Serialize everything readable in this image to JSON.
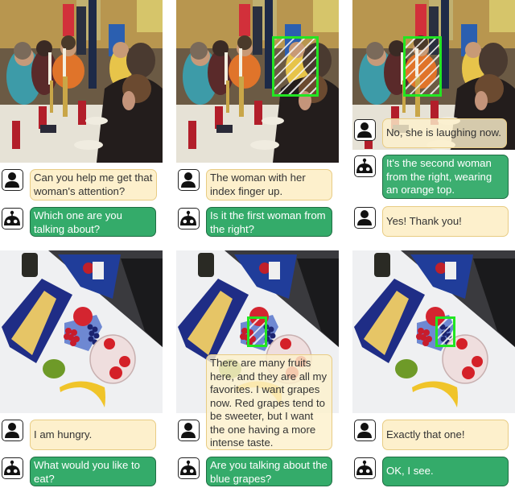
{
  "figure": {
    "rows": [
      {
        "scene": "dining-hall-table",
        "panels": [
          {
            "highlight": null,
            "dialogue": [
              {
                "speaker": "user",
                "text": "Can you help me get that woman's attention?"
              },
              {
                "speaker": "robot",
                "text": "Which one are you talking about?"
              }
            ]
          },
          {
            "highlight": "woman-with-index-finger-up",
            "dialogue": [
              {
                "speaker": "user",
                "text": "The woman with her index finger up."
              },
              {
                "speaker": "robot",
                "text": "Is it the first woman from the right?"
              }
            ]
          },
          {
            "highlight": "woman-in-orange-top",
            "dialogue": [
              {
                "speaker": "user",
                "text": "No, she is laughing now."
              },
              {
                "speaker": "robot",
                "text": "It's the second woman from the right, wearing an orange top."
              },
              {
                "speaker": "user",
                "text": "Yes! Thank you!"
              }
            ]
          }
        ]
      },
      {
        "scene": "fruits-on-table",
        "panels": [
          {
            "highlight": null,
            "dialogue": [
              {
                "speaker": "user",
                "text": "I am hungry."
              },
              {
                "speaker": "robot",
                "text": "What would you like to eat?"
              }
            ]
          },
          {
            "highlight": "blue-grapes",
            "dialogue": [
              {
                "speaker": "user",
                "text": "There are many fruits here, and they are all my favorites. I want grapes now. Red grapes tend to be sweeter, but I want the one having a more intense taste."
              },
              {
                "speaker": "robot",
                "text": "Are you talking about the blue grapes?"
              }
            ]
          },
          {
            "highlight": "blue-grapes",
            "dialogue": [
              {
                "speaker": "user",
                "text": "Exactly that one!"
              },
              {
                "speaker": "robot",
                "text": "OK, I see."
              }
            ]
          }
        ]
      }
    ]
  },
  "icons": {
    "user": "user-silhouette-icon",
    "robot": "robot-head-icon"
  },
  "colors": {
    "user_bubble": "#fdf0cc",
    "user_border": "#e8cc84",
    "robot_bubble": "#34ab6a",
    "robot_border": "#1f6e43",
    "highlight_box": "#22e622"
  }
}
